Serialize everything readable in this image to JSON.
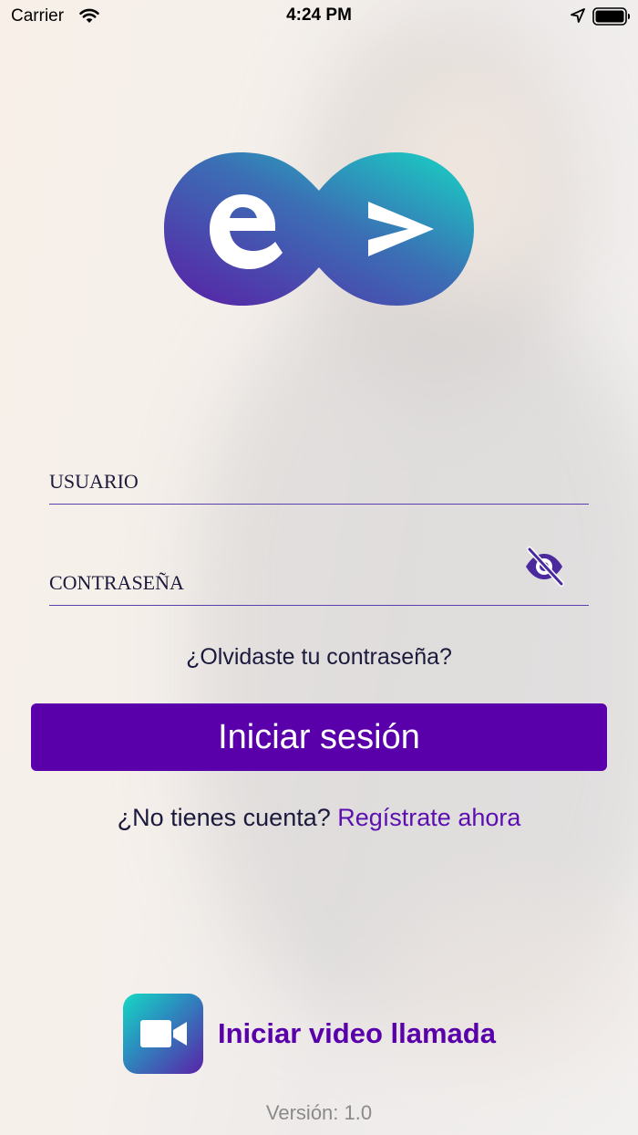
{
  "status_bar": {
    "carrier": "Carrier",
    "time": "4:24 PM",
    "icons": [
      "wifi-icon",
      "location-arrow-icon",
      "battery-icon"
    ]
  },
  "logo": {
    "name": "eo-logo-icon",
    "gradient_start": "#5a1fa6",
    "gradient_end": "#17d6c4"
  },
  "login_form": {
    "username_placeholder": "USUARIO",
    "password_placeholder": "CONTRASEÑA",
    "password_visibility_icon": "eye-slash-icon",
    "forgot_password": "¿Olvidaste tu contraseña?",
    "login_button": "Iniciar sesión"
  },
  "signup": {
    "prompt": "¿No tienes cuenta?",
    "link": "Regístrate ahora"
  },
  "video_call": {
    "icon": "video-camera-icon",
    "label": "Iniciar video llamada"
  },
  "version": "Versión: 1.0",
  "colors": {
    "primary": "#5900aa",
    "text": "#1b1a3c",
    "field_underline": "#5b3fae",
    "version_text": "#8a8a8a"
  }
}
